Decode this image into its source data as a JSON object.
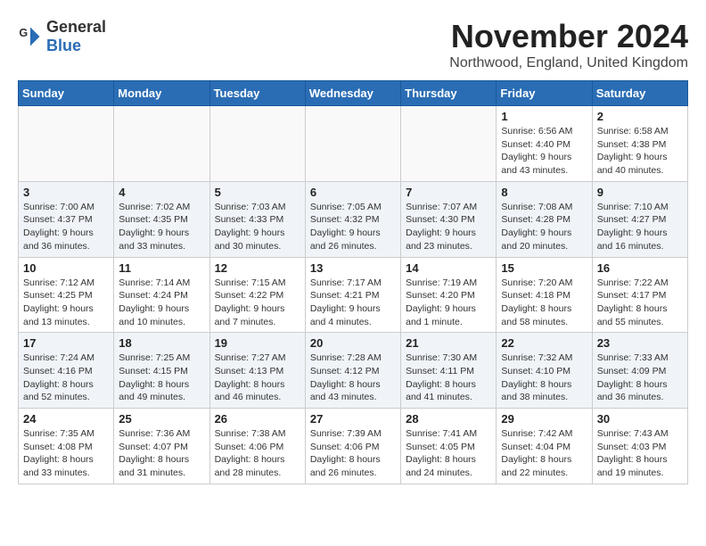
{
  "header": {
    "logo_general": "General",
    "logo_blue": "Blue",
    "month_title": "November 2024",
    "location": "Northwood, England, United Kingdom"
  },
  "weekdays": [
    "Sunday",
    "Monday",
    "Tuesday",
    "Wednesday",
    "Thursday",
    "Friday",
    "Saturday"
  ],
  "weeks": [
    [
      {
        "day": "",
        "info": ""
      },
      {
        "day": "",
        "info": ""
      },
      {
        "day": "",
        "info": ""
      },
      {
        "day": "",
        "info": ""
      },
      {
        "day": "",
        "info": ""
      },
      {
        "day": "1",
        "info": "Sunrise: 6:56 AM\nSunset: 4:40 PM\nDaylight: 9 hours\nand 43 minutes."
      },
      {
        "day": "2",
        "info": "Sunrise: 6:58 AM\nSunset: 4:38 PM\nDaylight: 9 hours\nand 40 minutes."
      }
    ],
    [
      {
        "day": "3",
        "info": "Sunrise: 7:00 AM\nSunset: 4:37 PM\nDaylight: 9 hours\nand 36 minutes."
      },
      {
        "day": "4",
        "info": "Sunrise: 7:02 AM\nSunset: 4:35 PM\nDaylight: 9 hours\nand 33 minutes."
      },
      {
        "day": "5",
        "info": "Sunrise: 7:03 AM\nSunset: 4:33 PM\nDaylight: 9 hours\nand 30 minutes."
      },
      {
        "day": "6",
        "info": "Sunrise: 7:05 AM\nSunset: 4:32 PM\nDaylight: 9 hours\nand 26 minutes."
      },
      {
        "day": "7",
        "info": "Sunrise: 7:07 AM\nSunset: 4:30 PM\nDaylight: 9 hours\nand 23 minutes."
      },
      {
        "day": "8",
        "info": "Sunrise: 7:08 AM\nSunset: 4:28 PM\nDaylight: 9 hours\nand 20 minutes."
      },
      {
        "day": "9",
        "info": "Sunrise: 7:10 AM\nSunset: 4:27 PM\nDaylight: 9 hours\nand 16 minutes."
      }
    ],
    [
      {
        "day": "10",
        "info": "Sunrise: 7:12 AM\nSunset: 4:25 PM\nDaylight: 9 hours\nand 13 minutes."
      },
      {
        "day": "11",
        "info": "Sunrise: 7:14 AM\nSunset: 4:24 PM\nDaylight: 9 hours\nand 10 minutes."
      },
      {
        "day": "12",
        "info": "Sunrise: 7:15 AM\nSunset: 4:22 PM\nDaylight: 9 hours\nand 7 minutes."
      },
      {
        "day": "13",
        "info": "Sunrise: 7:17 AM\nSunset: 4:21 PM\nDaylight: 9 hours\nand 4 minutes."
      },
      {
        "day": "14",
        "info": "Sunrise: 7:19 AM\nSunset: 4:20 PM\nDaylight: 9 hours\nand 1 minute."
      },
      {
        "day": "15",
        "info": "Sunrise: 7:20 AM\nSunset: 4:18 PM\nDaylight: 8 hours\nand 58 minutes."
      },
      {
        "day": "16",
        "info": "Sunrise: 7:22 AM\nSunset: 4:17 PM\nDaylight: 8 hours\nand 55 minutes."
      }
    ],
    [
      {
        "day": "17",
        "info": "Sunrise: 7:24 AM\nSunset: 4:16 PM\nDaylight: 8 hours\nand 52 minutes."
      },
      {
        "day": "18",
        "info": "Sunrise: 7:25 AM\nSunset: 4:15 PM\nDaylight: 8 hours\nand 49 minutes."
      },
      {
        "day": "19",
        "info": "Sunrise: 7:27 AM\nSunset: 4:13 PM\nDaylight: 8 hours\nand 46 minutes."
      },
      {
        "day": "20",
        "info": "Sunrise: 7:28 AM\nSunset: 4:12 PM\nDaylight: 8 hours\nand 43 minutes."
      },
      {
        "day": "21",
        "info": "Sunrise: 7:30 AM\nSunset: 4:11 PM\nDaylight: 8 hours\nand 41 minutes."
      },
      {
        "day": "22",
        "info": "Sunrise: 7:32 AM\nSunset: 4:10 PM\nDaylight: 8 hours\nand 38 minutes."
      },
      {
        "day": "23",
        "info": "Sunrise: 7:33 AM\nSunset: 4:09 PM\nDaylight: 8 hours\nand 36 minutes."
      }
    ],
    [
      {
        "day": "24",
        "info": "Sunrise: 7:35 AM\nSunset: 4:08 PM\nDaylight: 8 hours\nand 33 minutes."
      },
      {
        "day": "25",
        "info": "Sunrise: 7:36 AM\nSunset: 4:07 PM\nDaylight: 8 hours\nand 31 minutes."
      },
      {
        "day": "26",
        "info": "Sunrise: 7:38 AM\nSunset: 4:06 PM\nDaylight: 8 hours\nand 28 minutes."
      },
      {
        "day": "27",
        "info": "Sunrise: 7:39 AM\nSunset: 4:06 PM\nDaylight: 8 hours\nand 26 minutes."
      },
      {
        "day": "28",
        "info": "Sunrise: 7:41 AM\nSunset: 4:05 PM\nDaylight: 8 hours\nand 24 minutes."
      },
      {
        "day": "29",
        "info": "Sunrise: 7:42 AM\nSunset: 4:04 PM\nDaylight: 8 hours\nand 22 minutes."
      },
      {
        "day": "30",
        "info": "Sunrise: 7:43 AM\nSunset: 4:03 PM\nDaylight: 8 hours\nand 19 minutes."
      }
    ]
  ]
}
